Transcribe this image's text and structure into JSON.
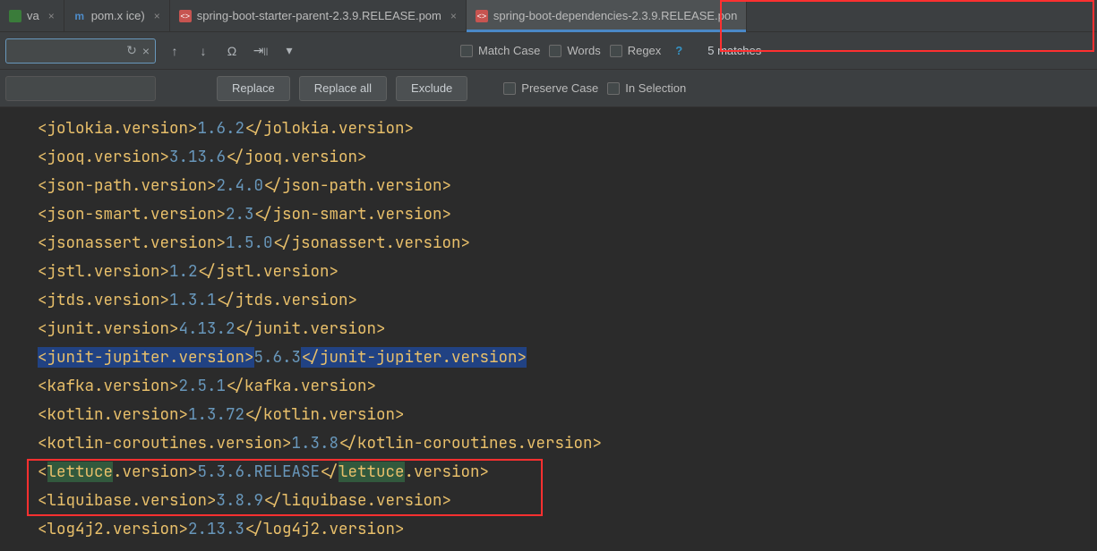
{
  "tabs": {
    "t0_label": "                   va",
    "t1_label": "pom.x           ice)",
    "t2_label": "spring-boot-starter-parent-2.3.9.RELEASE.pom",
    "t3_label": "spring-boot-dependencies-2.3.9.RELEASE.pon"
  },
  "find": {
    "matchcase": "Match Case",
    "words": "Words",
    "regex": "Regex",
    "question": "?",
    "matches": "5 matches",
    "replace": "Replace",
    "replaceall": "Replace all",
    "exclude": "Exclude",
    "preservecase": "Preserve Case",
    "inselection": "In Selection"
  },
  "code": {
    "l1_open": "<jolokia.version>",
    "l1_val": "1.6.2",
    "l1_close": "</jolokia.version>",
    "l2_open": "<jooq.version>",
    "l2_val": "3.13.6",
    "l2_close": "</jooq.version>",
    "l3_open": "<json-path.version>",
    "l3_val": "2.4.0",
    "l3_close": "</json-path.version>",
    "l4_open": "<json-smart.version>",
    "l4_val": "2.3",
    "l4_close": "</json-smart.version>",
    "l5_open": "<jsonassert.version>",
    "l5_val": "1.5.0",
    "l5_close": "</jsonassert.version>",
    "l6_open": "<jstl.version>",
    "l6_val": "1.2",
    "l6_close": "</jstl.version>",
    "l7_open": "<jtds.version>",
    "l7_val": "1.3.1",
    "l7_close": "</jtds.version>",
    "l8_open": "<junit.version>",
    "l8_val": "4.13.2",
    "l8_close": "</junit.version>",
    "l9_open": "<junit-jupiter.version>",
    "l9_val": "5.6.3",
    "l9_close": "</junit-jupiter.version>",
    "l10_open": "<kafka.version>",
    "l10_val": "2.5.1",
    "l10_close": "</kafka.version>",
    "l11_open": "<kotlin.version>",
    "l11_val": "1.3.72",
    "l11_close": "</kotlin.version>",
    "l12_open": "<kotlin-coroutines.version>",
    "l12_val": "1.3.8",
    "l12_close": "</kotlin-coroutines.version>",
    "l13_a": "<",
    "l13_hl1": "lettuce",
    "l13_b": ".version>",
    "l13_val": "5.3.6.RELEASE",
    "l13_c": "</",
    "l13_hl2": "lettuce",
    "l13_d": ".version>",
    "l14_open": "<liquibase.version>",
    "l14_val": "3.8.9",
    "l14_close": "</liquibase.version>",
    "l15_open": "<log4j2.version>",
    "l15_val": "2.13.3",
    "l15_close": "</log4j2.version>"
  }
}
